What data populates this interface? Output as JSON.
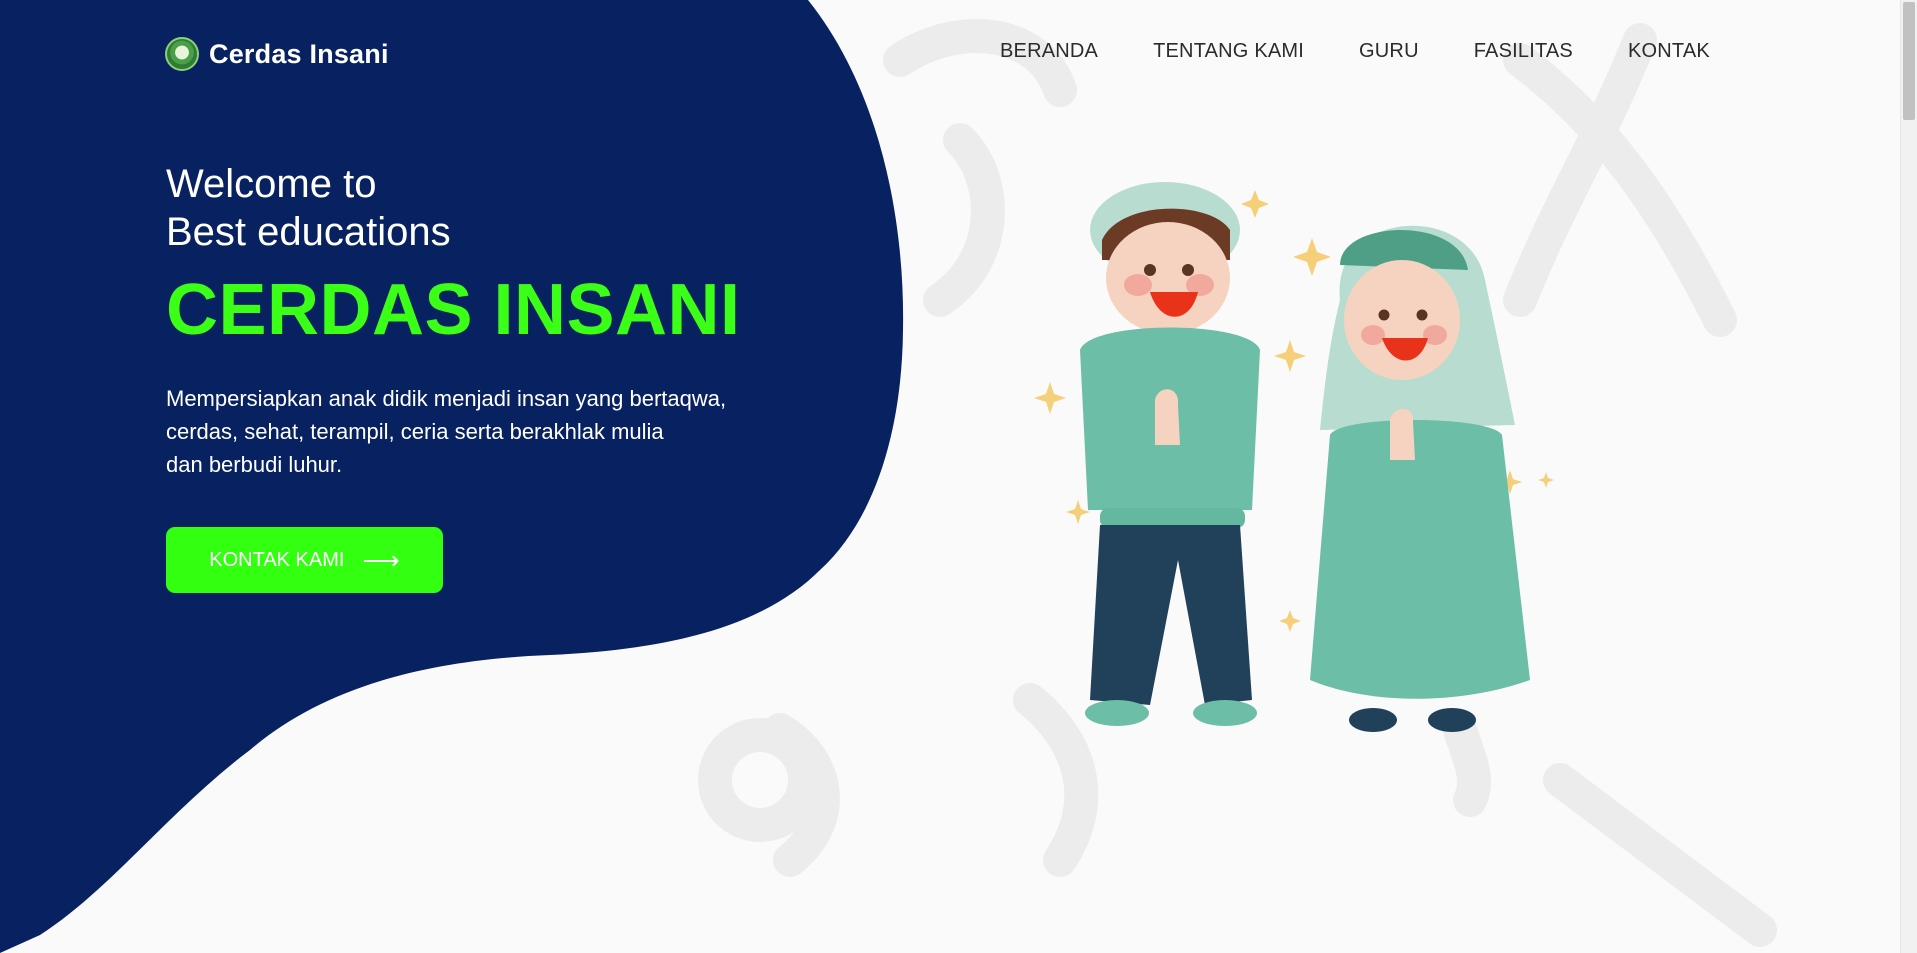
{
  "brand": {
    "name": "Cerdas Insani",
    "logo_icon": "school-emblem-icon"
  },
  "nav": {
    "items": [
      {
        "label": "BERANDA"
      },
      {
        "label": "TENTANG KAMI"
      },
      {
        "label": "GURU"
      },
      {
        "label": "FASILITAS"
      },
      {
        "label": "KONTAK"
      }
    ]
  },
  "hero": {
    "welcome_line1": "Welcome to",
    "welcome_line2": "Best educations",
    "title": "CERDAS INSANI",
    "description_line1": "Mempersiapkan anak didik menjadi insan yang bertaqwa,",
    "description_line2": "cerdas, sehat, terampil, ceria serta berakhlak mulia",
    "description_line3": "dan berbudi luhur.",
    "cta_label": "KONTAK KAMI",
    "cta_icon": "arrow-right-icon"
  },
  "colors": {
    "navy": "#082261",
    "accent_green": "#33ff11",
    "background": "#fafafa",
    "nav_text": "#2b2b2b"
  }
}
